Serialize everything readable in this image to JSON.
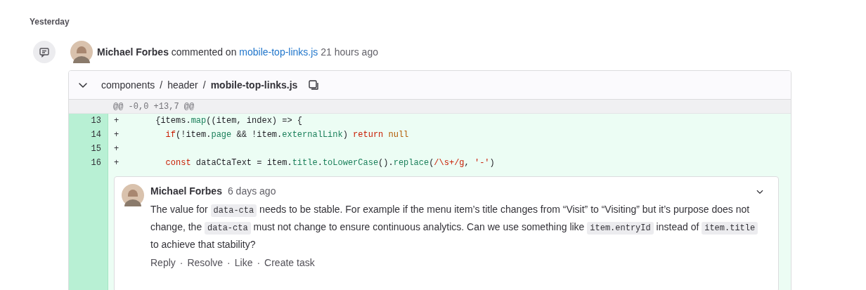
{
  "day_heading": "Yesterday",
  "event": {
    "author": "Michael Forbes",
    "verb": "commented on",
    "file_link": "mobile-top-links.js",
    "time": "21 hours ago"
  },
  "file_header": {
    "expanded": true,
    "path": [
      "components",
      "header",
      "mobile-top-links.js"
    ],
    "separator": "/"
  },
  "hunk_header": "@@ -0,0 +13,7 @@",
  "lines": [
    {
      "number": "13",
      "sign": "+",
      "tokens": [
        {
          "kind": "plain",
          "text": "      {items."
        },
        {
          "kind": "property",
          "text": "map"
        },
        {
          "kind": "plain",
          "text": "((item, index) => {"
        }
      ]
    },
    {
      "number": "14",
      "sign": "+",
      "tokens": [
        {
          "kind": "keyword",
          "text": "        if"
        },
        {
          "kind": "plain",
          "text": "(!item."
        },
        {
          "kind": "property",
          "text": "page"
        },
        {
          "kind": "plain",
          "text": " && !item."
        },
        {
          "kind": "property",
          "text": "externalLink"
        },
        {
          "kind": "plain",
          "text": ") "
        },
        {
          "kind": "keyword",
          "text": "return "
        },
        {
          "kind": "literal",
          "text": "null"
        }
      ]
    },
    {
      "number": "15",
      "sign": "+"
    },
    {
      "number": "16",
      "sign": "+",
      "tokens": [
        {
          "kind": "keyword",
          "text": "        const"
        },
        {
          "kind": "plain",
          "text": " dataCtaText = item."
        },
        {
          "kind": "property",
          "text": "title"
        },
        {
          "kind": "plain",
          "text": "."
        },
        {
          "kind": "property",
          "text": "toLowerCase"
        },
        {
          "kind": "plain",
          "text": "()."
        },
        {
          "kind": "property",
          "text": "replace"
        },
        {
          "kind": "plain",
          "text": "("
        },
        {
          "kind": "string",
          "text": "/\\s+/g"
        },
        {
          "kind": "plain",
          "text": ", "
        },
        {
          "kind": "string",
          "text": "'-'"
        },
        {
          "kind": "plain",
          "text": ")"
        }
      ]
    }
  ],
  "comment": {
    "author": "Michael Forbes",
    "time": "6 days ago",
    "body": [
      {
        "kind": "text",
        "text": "The value for "
      },
      {
        "kind": "code",
        "text": "data-cta"
      },
      {
        "kind": "text",
        "text": " needs to be stable. For example if the menu item’s title changes from “Visit” to “Visiting” but it’s purpose does not change, the "
      },
      {
        "kind": "code",
        "text": "data-cta"
      },
      {
        "kind": "text",
        "text": " must not change to ensure continuous analytics. Can we use something like "
      },
      {
        "kind": "code",
        "text": "item.entryId"
      },
      {
        "kind": "text",
        "text": " instead of "
      },
      {
        "kind": "code",
        "text": "item.title"
      },
      {
        "kind": "text",
        "text": " to achieve that stability?"
      }
    ],
    "actions": [
      "Reply",
      "Resolve",
      "Like",
      "Create task"
    ],
    "action_separator": "·"
  }
}
